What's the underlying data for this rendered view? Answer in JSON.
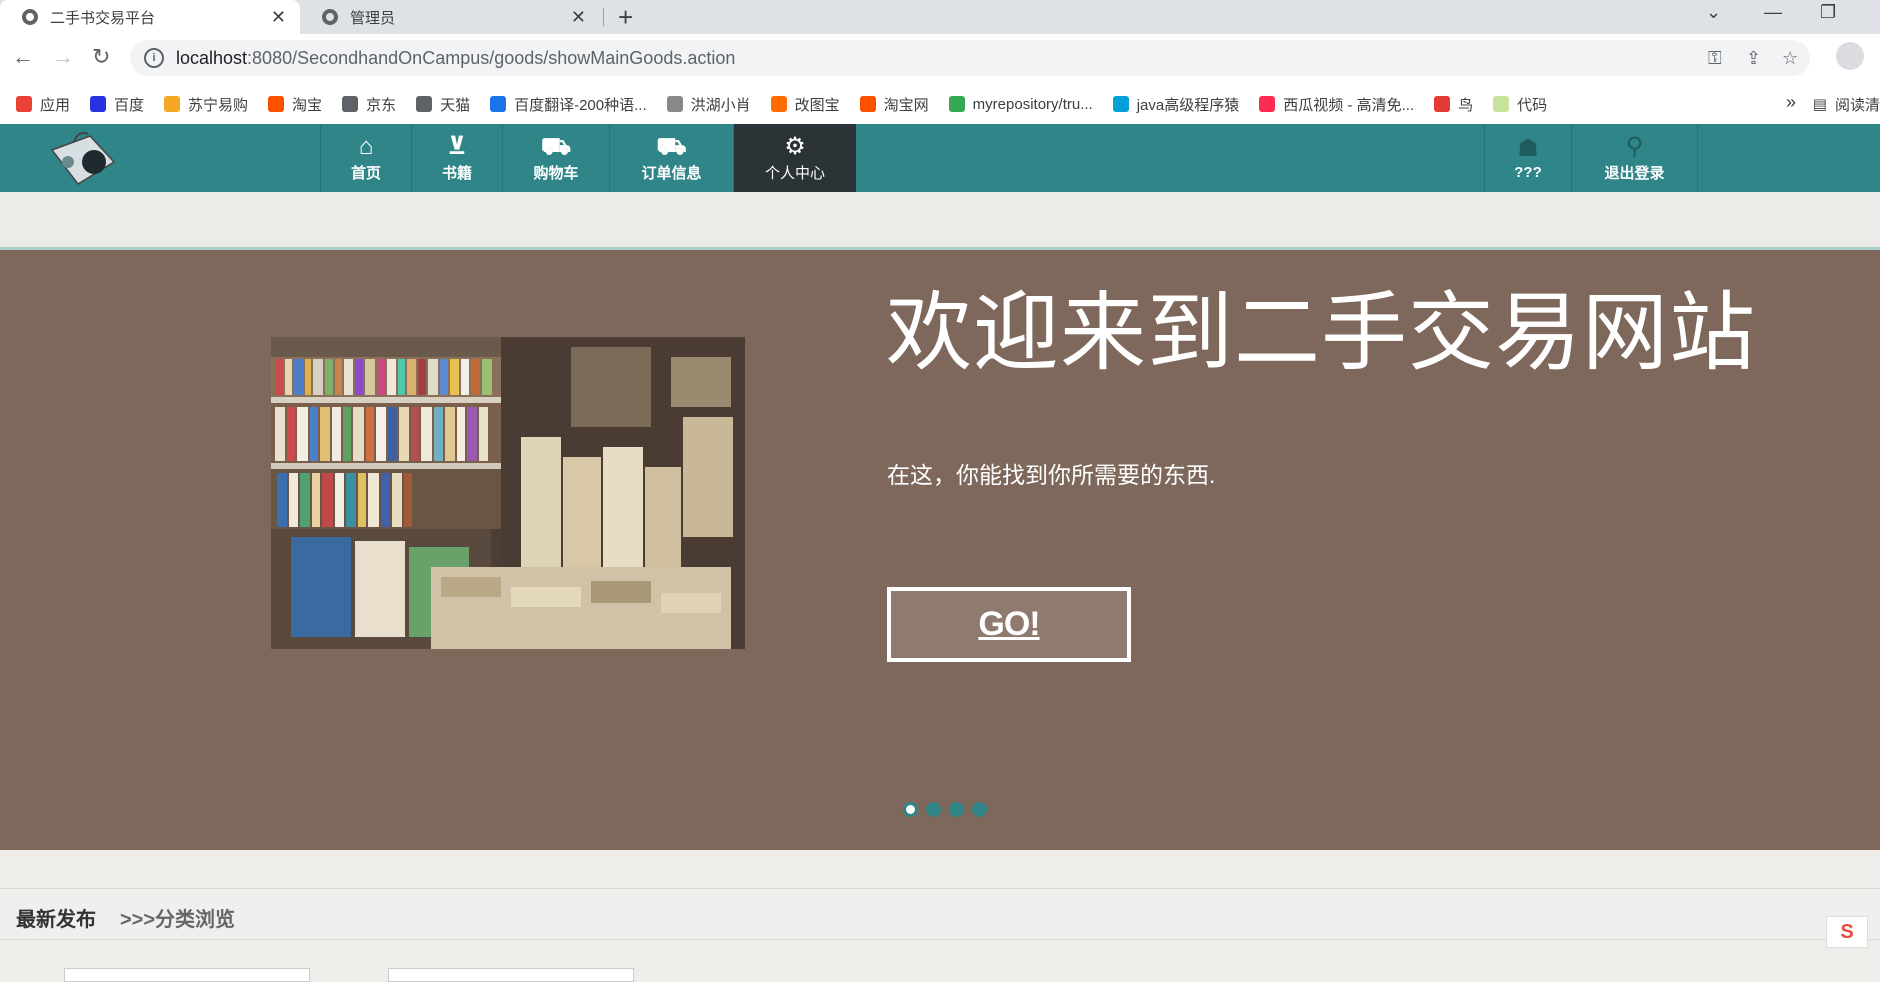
{
  "browser": {
    "tabs": [
      {
        "title": "二手书交易平台",
        "active": true
      },
      {
        "title": "管理员",
        "active": false
      }
    ],
    "url_host": "localhost",
    "url_rest": ":8080/SecondhandOnCampus/goods/showMainGoods.action",
    "bookmarks": [
      {
        "label": "应用",
        "color": "#ea4335"
      },
      {
        "label": "百度",
        "color": "#2932e1"
      },
      {
        "label": "苏宁易购",
        "color": "#f5a623"
      },
      {
        "label": "淘宝",
        "color": "#ff5000"
      },
      {
        "label": "京东",
        "color": "#5f6368"
      },
      {
        "label": "天猫",
        "color": "#5f6368"
      },
      {
        "label": "百度翻译-200种语...",
        "color": "#1a73e8"
      },
      {
        "label": "洪湖小肖",
        "color": "#888888"
      },
      {
        "label": "改图宝",
        "color": "#ff6d00"
      },
      {
        "label": "淘宝网",
        "color": "#ff5000"
      },
      {
        "label": "myrepository/tru...",
        "color": "#34a853"
      },
      {
        "label": "java高级程序猿",
        "color": "#00a1d6"
      },
      {
        "label": "西瓜视频 - 高清免...",
        "color": "#fe2c55"
      },
      {
        "label": "鸟",
        "color": "#e53935"
      },
      {
        "label": "代码",
        "color": "#c6e39a"
      }
    ],
    "more": "»",
    "reading_list": "阅读清"
  },
  "site_nav": {
    "items": [
      {
        "label": "首页",
        "icon": "home-icon"
      },
      {
        "label": "书籍",
        "icon": "basket-icon"
      },
      {
        "label": "购物车",
        "icon": "cart-icon"
      },
      {
        "label": "订单信息",
        "icon": "truck-icon"
      },
      {
        "label": "个人中心",
        "icon": "user-settings-icon"
      }
    ],
    "right_items": [
      {
        "label": "???",
        "icon": "users-icon"
      },
      {
        "label": "退出登录",
        "icon": "pin-icon"
      }
    ]
  },
  "hero": {
    "title": "欢迎来到二手交易网站",
    "subtitle": "在这，你能找到你所需要的东西.",
    "button": "GO!",
    "slides": 4,
    "active_slide": 1
  },
  "listing": {
    "tab_latest": "最新发布",
    "tab_browse": ">>>分类浏览"
  },
  "badge": "S"
}
